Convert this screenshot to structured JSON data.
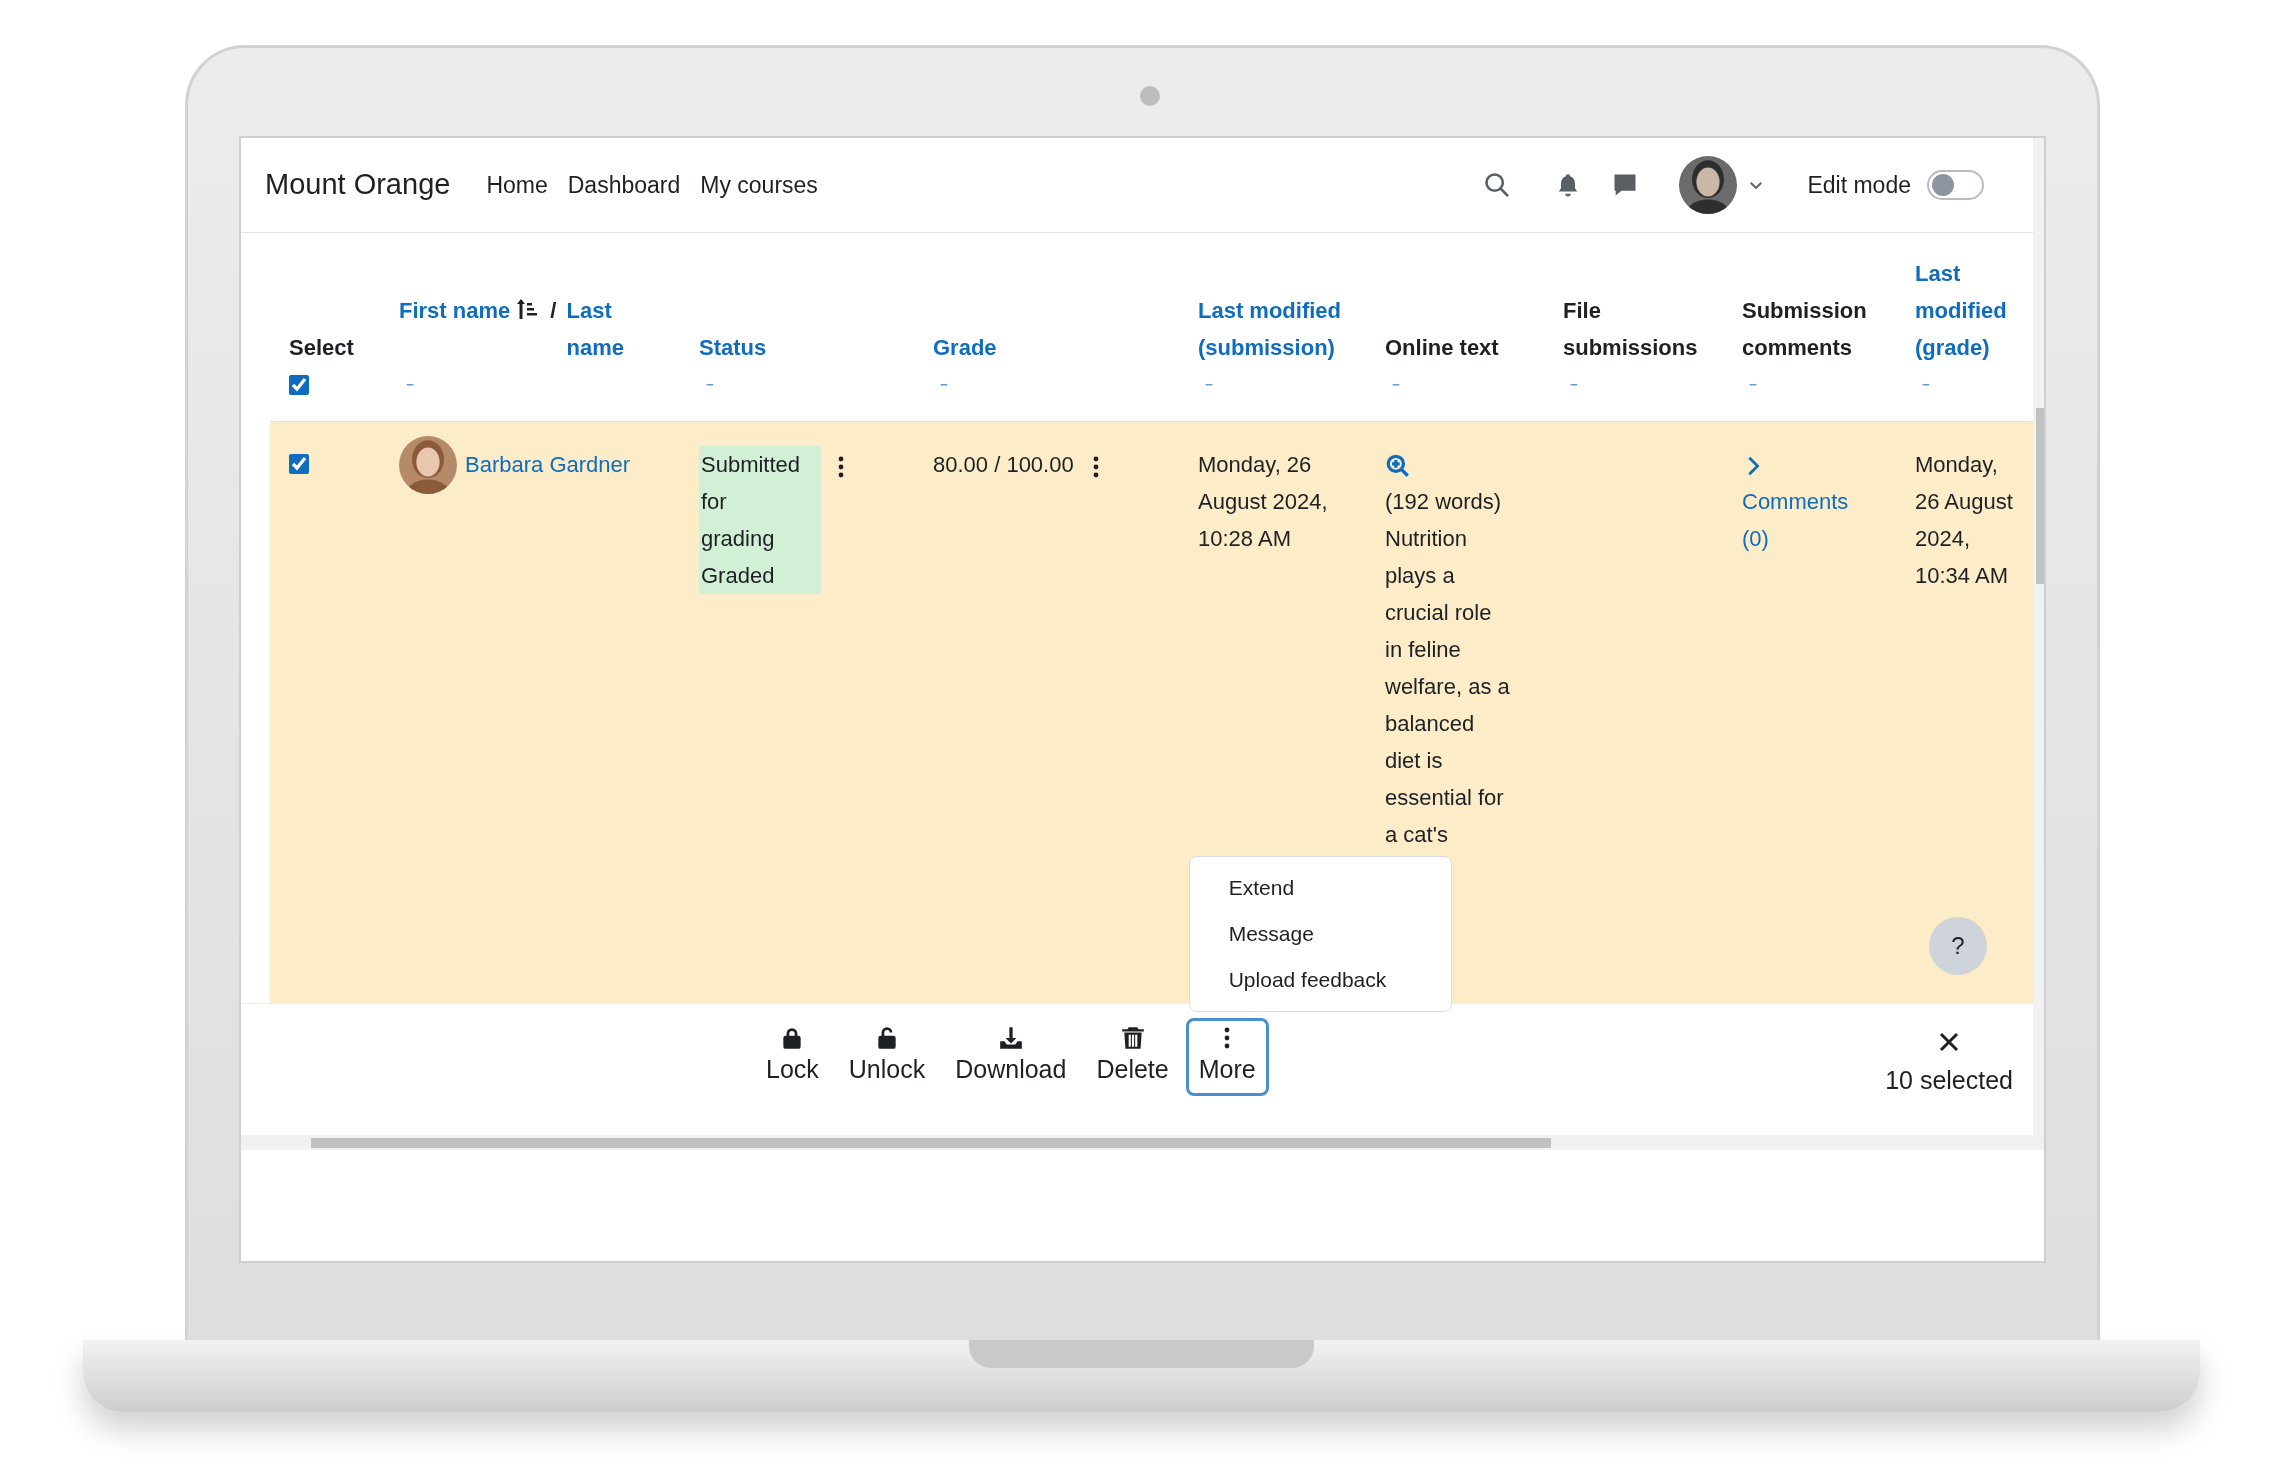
{
  "navbar": {
    "brand": "Mount Orange",
    "links": [
      "Home",
      "Dashboard",
      "My courses"
    ],
    "edit_mode": {
      "label": "Edit mode",
      "on": false
    }
  },
  "table": {
    "columns": [
      {
        "kind": "select",
        "label": "Select",
        "checked": true
      },
      {
        "kind": "name",
        "first": "First name",
        "sorted": true,
        "separator": "/",
        "last": "Last name"
      },
      {
        "kind": "text",
        "label": "Status",
        "link": true
      },
      {
        "kind": "text",
        "label": "Grade",
        "link": true
      },
      {
        "kind": "text",
        "label": "Last modified (submission)",
        "link": true
      },
      {
        "kind": "text",
        "label": "Online text",
        "link": false
      },
      {
        "kind": "text",
        "label": "File submissions",
        "link": false
      },
      {
        "kind": "text",
        "label": "Submission comments",
        "link": false
      },
      {
        "kind": "text",
        "label": "Last modified (grade)",
        "link": true
      }
    ],
    "rows": [
      {
        "selected": true,
        "name": "Barbara Gardner",
        "status": [
          "Submitted for grading",
          "Graded"
        ],
        "grade": "80.00 / 100.00",
        "last_modified": "Monday, 26 August 2024, 10:28 AM",
        "online_text": "(192 words) Nutrition plays a crucial role in feline welfare, as a balanced diet is essential for a cat's",
        "comments": "Comments (0)",
        "grade_modified": "Monday, 26 August 2024, 10:34 AM"
      }
    ]
  },
  "menu": {
    "items": [
      "Extend",
      "Message",
      "Upload feedback"
    ]
  },
  "help": "?",
  "actions": [
    {
      "label": "Lock",
      "kind": "lock",
      "selected": false
    },
    {
      "label": "Unlock",
      "kind": "unlock",
      "selected": false
    },
    {
      "label": "Download",
      "kind": "download",
      "selected": false
    },
    {
      "label": "Delete",
      "kind": "delete",
      "selected": false
    },
    {
      "label": "More",
      "kind": "more",
      "selected": true
    }
  ],
  "selection": {
    "count": "10 selected"
  }
}
